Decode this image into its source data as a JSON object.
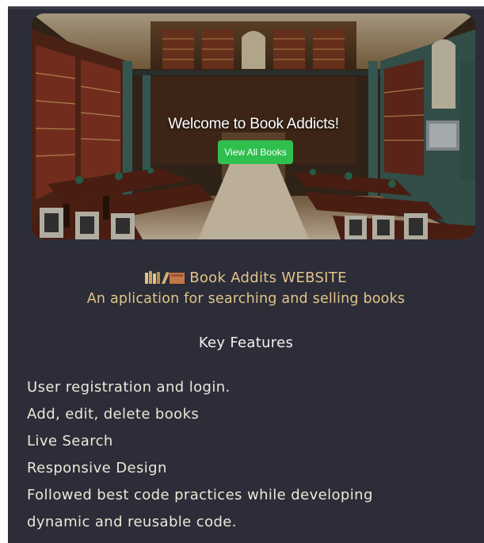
{
  "hero": {
    "title": "Welcome to Book Addicts!",
    "button_label": "View All Books",
    "button_color": "#2fbf4f",
    "image_description_icon": "library-photo"
  },
  "info": {
    "icon": "books-icon",
    "title": "Book Addits WEBSITE",
    "subtitle": "An aplication for searching and selling books",
    "features_heading": "Key Features",
    "features": [
      "User registration and login.",
      "Add, edit, delete books",
      "Live Search",
      "Responsive Design",
      "Followed best code practices while developing",
      "dynamic and reusable code."
    ]
  },
  "colors": {
    "background": "#2c2d38",
    "accent_text": "#e2c48a",
    "body_text": "#ede7d8",
    "heading_text": "#f2f2f2"
  }
}
